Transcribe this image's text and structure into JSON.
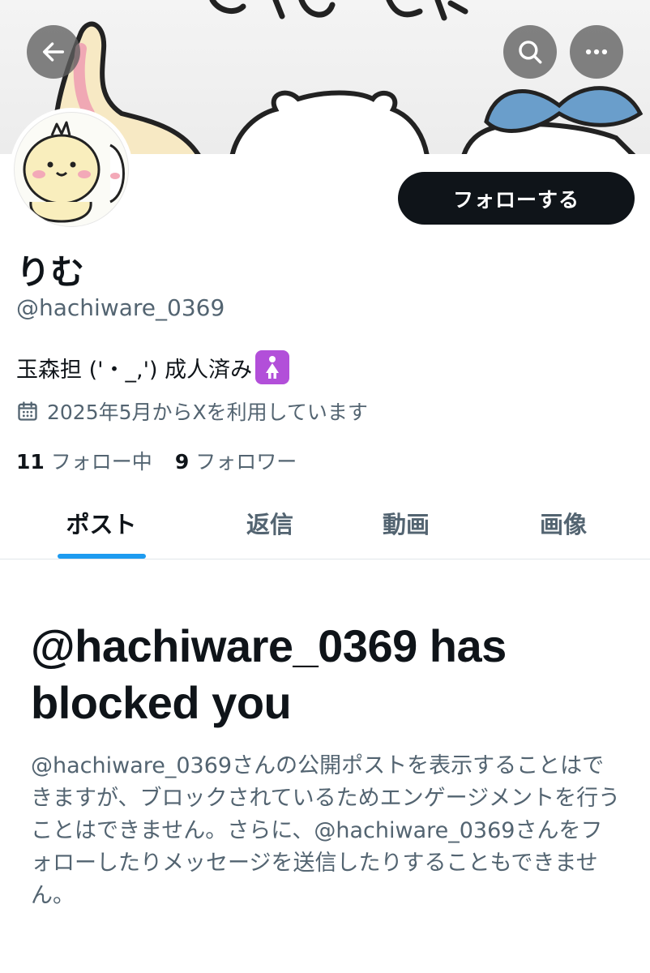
{
  "header": {
    "back_icon": "arrow-left-icon",
    "search_icon": "search-icon",
    "more_icon": "more-horizontal-icon"
  },
  "profile": {
    "follow_label": "フォローする",
    "display_name": "りむ",
    "handle": "@hachiware_0369",
    "bio": "玉森担 ('・_,') 成人済み",
    "bio_emoji": "🚺",
    "joined": "2025年5月からXを利用しています",
    "following_count": "11",
    "following_label": "フォロー中",
    "followers_count": "9",
    "followers_label": "フォロワー"
  },
  "tabs": [
    {
      "label": "ポスト",
      "active": true
    },
    {
      "label": "返信",
      "active": false
    },
    {
      "label": "動画",
      "active": false
    },
    {
      "label": "画像",
      "active": false
    }
  ],
  "blocked": {
    "title": "@hachiware_0369 has blocked you",
    "message": "@hachiware_0369さんの公開ポストを表示することはできますが、ブロックされているためエンゲージメントを行うことはできません。さらに、@hachiware_0369さんをフォローしたりメッセージを送信したりすることもできません。"
  },
  "colors": {
    "accent": "#1d9bf0",
    "text_primary": "#0f1419",
    "text_secondary": "#536471"
  }
}
